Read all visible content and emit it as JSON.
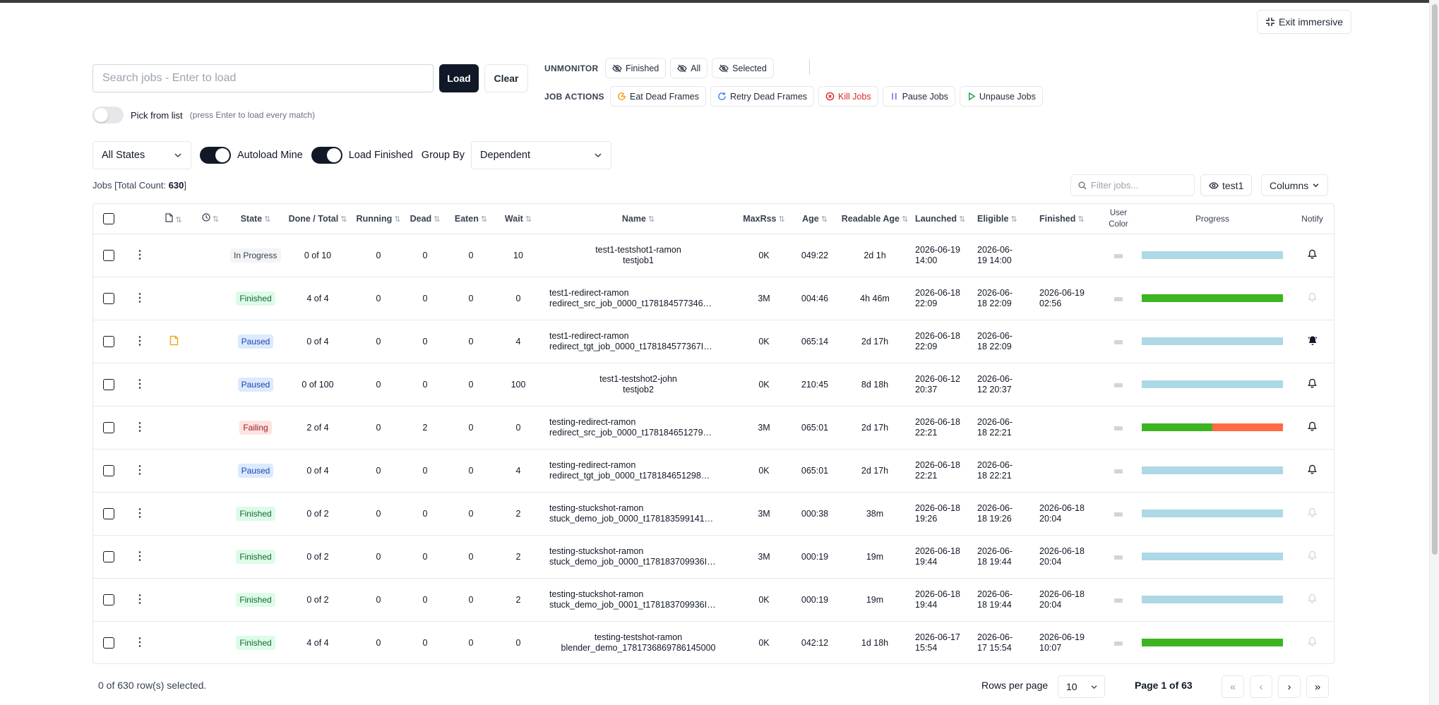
{
  "toolbar": {
    "exit_immersive": "Exit immersive",
    "search_placeholder": "Search jobs - Enter to load",
    "load": "Load",
    "clear": "Clear",
    "pick_from_list": "Pick from list",
    "pick_hint": "(press Enter to load every match)",
    "unmonitor_label": "UNMONITOR",
    "unmonitor_buttons": [
      "Finished",
      "All",
      "Selected"
    ],
    "job_actions_label": "JOB ACTIONS",
    "job_action_buttons": [
      "Eat Dead Frames",
      "Retry Dead Frames",
      "Kill Jobs",
      "Pause Jobs",
      "Unpause Jobs"
    ]
  },
  "filters": {
    "state_select": "All States",
    "autoload_mine": "Autoload Mine",
    "load_finished": "Load Finished",
    "group_by_label": "Group By",
    "group_by_value": "Dependent"
  },
  "summary": {
    "prefix": "Jobs [Total Count: ",
    "total": "630",
    "suffix": "]",
    "filter_placeholder": "Filter jobs...",
    "user": "test1",
    "columns": "Columns"
  },
  "table": {
    "headers": {
      "state": "State",
      "done_total": "Done / Total",
      "running": "Running",
      "dead": "Dead",
      "eaten": "Eaten",
      "wait": "Wait",
      "name": "Name",
      "maxrss": "MaxRss",
      "age": "Age",
      "readable_age": "Readable Age",
      "launched": "Launched",
      "eligible": "Eligible",
      "finished": "Finished",
      "user_color_1": "User",
      "user_color_2": "Color",
      "progress": "Progress",
      "notify": "Notify"
    },
    "rows": [
      {
        "state": "In Progress",
        "state_type": "progress",
        "done_total": "0 of 10",
        "running": "0",
        "dead": "0",
        "eaten": "0",
        "wait": "10",
        "name1": "test1-testshot1-ramon",
        "name2": "testjob1",
        "centered": true,
        "maxrss": "0K",
        "age": "049:22",
        "readable_age": "2d 1h",
        "launched1": "2026-06-19",
        "launched2": "14:00",
        "eligible1": "2026-06-",
        "eligible2": "19 14:00",
        "finished1": "",
        "finished2": "",
        "done_pct": 0,
        "dead_pct": 0,
        "notify": "bell",
        "has_doc": false
      },
      {
        "state": "Finished",
        "state_type": "finished",
        "done_total": "4 of 4",
        "running": "0",
        "dead": "0",
        "eaten": "0",
        "wait": "0",
        "name1": "test1-redirect-ramon",
        "name2": "redirect_src_job_0000_t178184577346…",
        "centered": false,
        "maxrss": "3M",
        "age": "004:46",
        "readable_age": "4h 46m",
        "launched1": "2026-06-18",
        "launched2": "22:09",
        "eligible1": "2026-06-",
        "eligible2": "18 22:09",
        "finished1": "2026-06-19",
        "finished2": "02:56",
        "done_pct": 100,
        "dead_pct": 0,
        "notify": "bell-muted",
        "has_doc": false
      },
      {
        "state": "Paused",
        "state_type": "paused",
        "done_total": "0 of 4",
        "running": "0",
        "dead": "0",
        "eaten": "0",
        "wait": "4",
        "name1": "test1-redirect-ramon",
        "name2": "redirect_tgt_job_0000_t178184577367I…",
        "centered": false,
        "maxrss": "0K",
        "age": "065:14",
        "readable_age": "2d 17h",
        "launched1": "2026-06-18",
        "launched2": "22:09",
        "eligible1": "2026-06-",
        "eligible2": "18 22:09",
        "finished1": "",
        "finished2": "",
        "done_pct": 0,
        "dead_pct": 0,
        "notify": "bell-ring",
        "has_doc": true
      },
      {
        "state": "Paused",
        "state_type": "paused",
        "done_total": "0 of 100",
        "running": "0",
        "dead": "0",
        "eaten": "0",
        "wait": "100",
        "name1": "test1-testshot2-john",
        "name2": "testjob2",
        "centered": true,
        "maxrss": "0K",
        "age": "210:45",
        "readable_age": "8d 18h",
        "launched1": "2026-06-12",
        "launched2": "20:37",
        "eligible1": "2026-06-",
        "eligible2": "12 20:37",
        "finished1": "",
        "finished2": "",
        "done_pct": 0,
        "dead_pct": 0,
        "notify": "bell",
        "has_doc": false
      },
      {
        "state": "Failing",
        "state_type": "failing",
        "done_total": "2 of 4",
        "running": "0",
        "dead": "2",
        "eaten": "0",
        "wait": "0",
        "name1": "testing-redirect-ramon",
        "name2": "redirect_src_job_0000_t178184651279…",
        "centered": false,
        "maxrss": "3M",
        "age": "065:01",
        "readable_age": "2d 17h",
        "launched1": "2026-06-18",
        "launched2": "22:21",
        "eligible1": "2026-06-",
        "eligible2": "18 22:21",
        "finished1": "",
        "finished2": "",
        "done_pct": 50,
        "dead_pct": 50,
        "notify": "bell",
        "has_doc": false
      },
      {
        "state": "Paused",
        "state_type": "paused",
        "done_total": "0 of 4",
        "running": "0",
        "dead": "0",
        "eaten": "0",
        "wait": "4",
        "name1": "testing-redirect-ramon",
        "name2": "redirect_tgt_job_0000_t178184651298…",
        "centered": false,
        "maxrss": "0K",
        "age": "065:01",
        "readable_age": "2d 17h",
        "launched1": "2026-06-18",
        "launched2": "22:21",
        "eligible1": "2026-06-",
        "eligible2": "18 22:21",
        "finished1": "",
        "finished2": "",
        "done_pct": 0,
        "dead_pct": 0,
        "notify": "bell",
        "has_doc": false
      },
      {
        "state": "Finished",
        "state_type": "finished",
        "done_total": "0 of 2",
        "running": "0",
        "dead": "0",
        "eaten": "0",
        "wait": "2",
        "name1": "testing-stuckshot-ramon",
        "name2": "stuck_demo_job_0000_t178183599141…",
        "centered": false,
        "maxrss": "3M",
        "age": "000:38",
        "readable_age": "38m",
        "launched1": "2026-06-18",
        "launched2": "19:26",
        "eligible1": "2026-06-",
        "eligible2": "18 19:26",
        "finished1": "2026-06-18",
        "finished2": "20:04",
        "done_pct": 0,
        "dead_pct": 0,
        "notify": "bell-muted",
        "has_doc": false
      },
      {
        "state": "Finished",
        "state_type": "finished",
        "done_total": "0 of 2",
        "running": "0",
        "dead": "0",
        "eaten": "0",
        "wait": "2",
        "name1": "testing-stuckshot-ramon",
        "name2": "stuck_demo_job_0000_t178183709936I…",
        "centered": false,
        "maxrss": "3M",
        "age": "000:19",
        "readable_age": "19m",
        "launched1": "2026-06-18",
        "launched2": "19:44",
        "eligible1": "2026-06-",
        "eligible2": "18 19:44",
        "finished1": "2026-06-18",
        "finished2": "20:04",
        "done_pct": 0,
        "dead_pct": 0,
        "notify": "bell-muted",
        "has_doc": false
      },
      {
        "state": "Finished",
        "state_type": "finished",
        "done_total": "0 of 2",
        "running": "0",
        "dead": "0",
        "eaten": "0",
        "wait": "2",
        "name1": "testing-stuckshot-ramon",
        "name2": "stuck_demo_job_0001_t178183709936I…",
        "centered": false,
        "maxrss": "0K",
        "age": "000:19",
        "readable_age": "19m",
        "launched1": "2026-06-18",
        "launched2": "19:44",
        "eligible1": "2026-06-",
        "eligible2": "18 19:44",
        "finished1": "2026-06-18",
        "finished2": "20:04",
        "done_pct": 0,
        "dead_pct": 0,
        "notify": "bell-muted",
        "has_doc": false
      },
      {
        "state": "Finished",
        "state_type": "finished",
        "done_total": "4 of 4",
        "running": "0",
        "dead": "0",
        "eaten": "0",
        "wait": "0",
        "name1": "testing-testshot-ramon",
        "name2": "blender_demo_1781736869786145000",
        "centered": true,
        "maxrss": "0K",
        "age": "042:12",
        "readable_age": "1d 18h",
        "launched1": "2026-06-17",
        "launched2": "15:54",
        "eligible1": "2026-06-",
        "eligible2": "17 15:54",
        "finished1": "2026-06-19",
        "finished2": "10:07",
        "done_pct": 100,
        "dead_pct": 0,
        "notify": "bell-muted",
        "has_doc": false
      }
    ]
  },
  "footer": {
    "selected": "0 of 630 row(s) selected.",
    "rows_per_page_label": "Rows per page",
    "rows_per_page": "10",
    "page": "Page 1 of 63"
  },
  "colors": {
    "done": "#3cb521",
    "dead": "#ff6a45",
    "waiting": "#add8e6",
    "primary": "#111827"
  }
}
